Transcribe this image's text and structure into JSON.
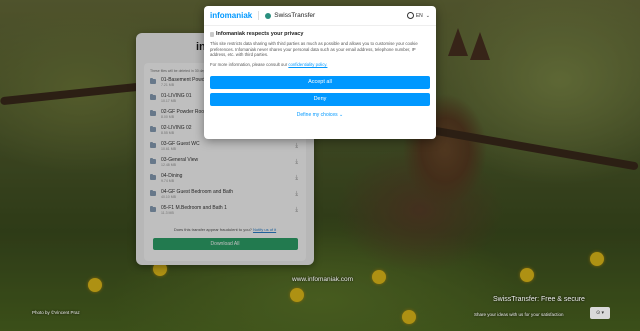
{
  "consent": {
    "brand": "infomaniak",
    "product": "SwissTransfer",
    "language": "EN",
    "title": "Infomaniak respects your privacy",
    "text": "This site restricts data sharing with third parties as much as possible and allows you to customise your cookie preferences. Infomaniak never shares your personal data such as your email address, telephone number, IP address, etc. with third parties.",
    "more_prefix": "For more information, please consult our ",
    "more_link": "confidentiality policy.",
    "accept_label": "Accept all",
    "deny_label": "Deny",
    "define_label": "Define my choices"
  },
  "transfer": {
    "logo": "infomaniak",
    "note": "These files will be deleted in 30 days",
    "files": [
      {
        "name": "01-Basement Powder Room",
        "size": "7.21 MB"
      },
      {
        "name": "01-LIVING 01",
        "size": "10.17 MB"
      },
      {
        "name": "02-GF Powder Room",
        "size": "8.00 MB"
      },
      {
        "name": "02-LIVING 02",
        "size": "8.55 MB"
      },
      {
        "name": "03-GF Guest WC",
        "size": "10.61 MB"
      },
      {
        "name": "03-General View",
        "size": "12.48 MB"
      },
      {
        "name": "04-Dining",
        "size": "9.74 MB"
      },
      {
        "name": "04-GF Guest Bedroom and Bath",
        "size": "40.10 MB"
      },
      {
        "name": "05-F1 M.Bedroom and Bath 1",
        "size": "11.3 MB"
      }
    ],
    "fraud_text": "Does this transfer appear fraudulent to you? ",
    "fraud_link": "Notify us of it",
    "download_label": "Download All"
  },
  "footer": {
    "site_url": "www.infomaniak.com",
    "credit": "Photo by ©Vincent Praz",
    "tagline": "SwissTransfer: Free & secure",
    "share": "Share your ideas with us for your satisfaction",
    "share_select": "⊙ ▾"
  }
}
